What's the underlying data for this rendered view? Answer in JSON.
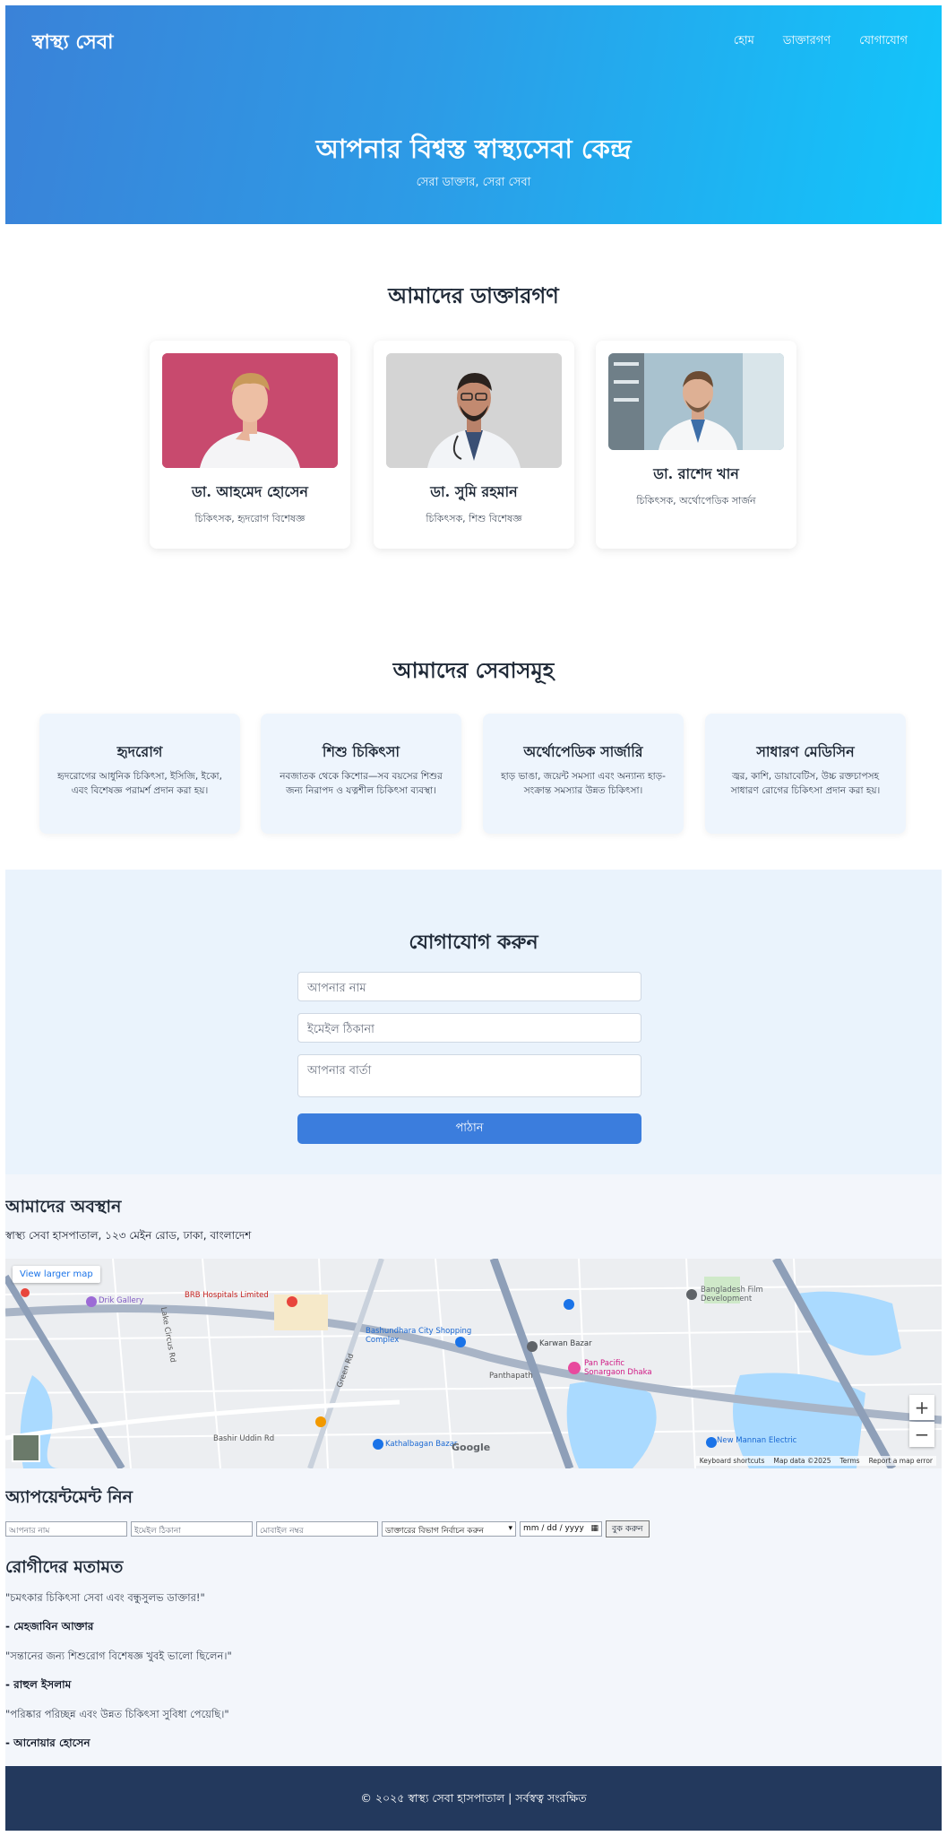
{
  "header": {
    "brand": "স্বাস্থ্য সেবা",
    "nav": [
      "হোম",
      "ডাক্তারগণ",
      "যোগাযোগ"
    ],
    "hero_title": "আপনার বিশ্বস্ত স্বাস্থ্যসেবা কেন্দ্র",
    "hero_subtitle": "সেরা ডাক্তার, সেরা সেবা"
  },
  "doctors": {
    "title": "আমাদের ডাক্তারগণ",
    "items": [
      {
        "name": "ডা. আহমেদ হোসেন",
        "specialty": "চিকিৎসক, হৃদরোগ বিশেষজ্ঞ"
      },
      {
        "name": "ডা. সুমি রহমান",
        "specialty": "চিকিৎসক, শিশু বিশেষজ্ঞ"
      },
      {
        "name": "ডা. রাশেদ খান",
        "specialty": "চিকিৎসক, অর্থোপেডিক সার্জন"
      }
    ]
  },
  "services": {
    "title": "আমাদের সেবাসমূহ",
    "items": [
      {
        "title": "হৃদরোগ",
        "description": "হৃদরোগের আধুনিক চিকিৎসা, ইসিজি, ইকো, এবং বিশেষজ্ঞ পরামর্শ প্রদান করা হয়।"
      },
      {
        "title": "শিশু চিকিৎসা",
        "description": "নবজাতক থেকে কিশোর—সব বয়সের শিশুর জন্য নিরাপদ ও যত্নশীল চিকিৎসা ব্যবস্থা।"
      },
      {
        "title": "অর্থোপেডিক সার্জারি",
        "description": "হাড় ভাঙা, জয়েন্ট সমস্যা এবং অন্যান্য হাড়-সংক্রান্ত সমস্যার উন্নত চিকিৎসা।"
      },
      {
        "title": "সাধারণ মেডিসিন",
        "description": "জ্বর, কাশি, ডায়াবেটিস, উচ্চ রক্তচাপসহ সাধারণ রোগের চিকিৎসা প্রদান করা হয়।"
      }
    ]
  },
  "contact": {
    "title": "যোগাযোগ করুন",
    "name_placeholder": "আপনার নাম",
    "email_placeholder": "ইমেইল ঠিকানা",
    "message_placeholder": "আপনার বার্তা",
    "submit_label": "পাঠান"
  },
  "location": {
    "title": "আমাদের অবস্থান",
    "address": "স্বাস্থ্য সেবা হাসপাতাল, ১২৩ মেইন রোড, ঢাকা, বাংলাদেশ",
    "map": {
      "larger_map": "View larger map",
      "zoom_in": "+",
      "zoom_out": "−",
      "footer": [
        "Keyboard shortcuts",
        "Map data ©2025",
        "Terms",
        "Report a map error"
      ],
      "labels": [
        "Drik Gallery",
        "BRB Hospitals Limited",
        "Bashundhara City Shopping Complex",
        "Karwan Bazar",
        "Pan Pacific Sonargaon Dhaka",
        "Bangladesh Film Development",
        "New Mannan Electric",
        "Kathalbagan Bazar",
        "Panthapath",
        "Green Rd",
        "Bashir Uddin Rd",
        "Lake Circus Rd",
        "Google"
      ]
    }
  },
  "appointment": {
    "title": "অ্যাপয়েন্টমেন্ট নিন",
    "name_placeholder": "আপনার নাম",
    "email_placeholder": "ইমেইল ঠিকানা",
    "phone_placeholder": "মোবাইল নম্বর",
    "department_selected": "ডাক্তারের বিভাগ নির্বাচন করুন",
    "date_placeholder": "mm / dd / yyyy",
    "submit_label": "বুক করুন"
  },
  "testimonials": {
    "title": "রোগীদের মতামত",
    "items": [
      {
        "quote": "\"চমৎকার চিকিৎসা সেবা এবং বন্ধুসুলভ ডাক্তার!\"",
        "author": "- মেহজাবিন আক্তার"
      },
      {
        "quote": "\"সন্তানের জন্য শিশুরোগ বিশেষজ্ঞ খুবই ভালো ছিলেন।\"",
        "author": "- রাহুল ইসলাম"
      },
      {
        "quote": "\"পরিষ্কার পরিচ্ছন্ন এবং উন্নত চিকিৎসা সুবিধা পেয়েছি।\"",
        "author": "- আনোয়ার হোসেন"
      }
    ]
  },
  "footer": {
    "copyright": "© ২০২৫ স্বাস্থ্য সেবা হাসপাতাল | সর্বস্বত্ব সংরক্ষিত"
  },
  "colors": {
    "hero_start": "#3a82d8",
    "hero_end": "#12c6fb",
    "button": "#3b7ddd",
    "footer": "#23395d",
    "service_card": "#eef5fd"
  }
}
